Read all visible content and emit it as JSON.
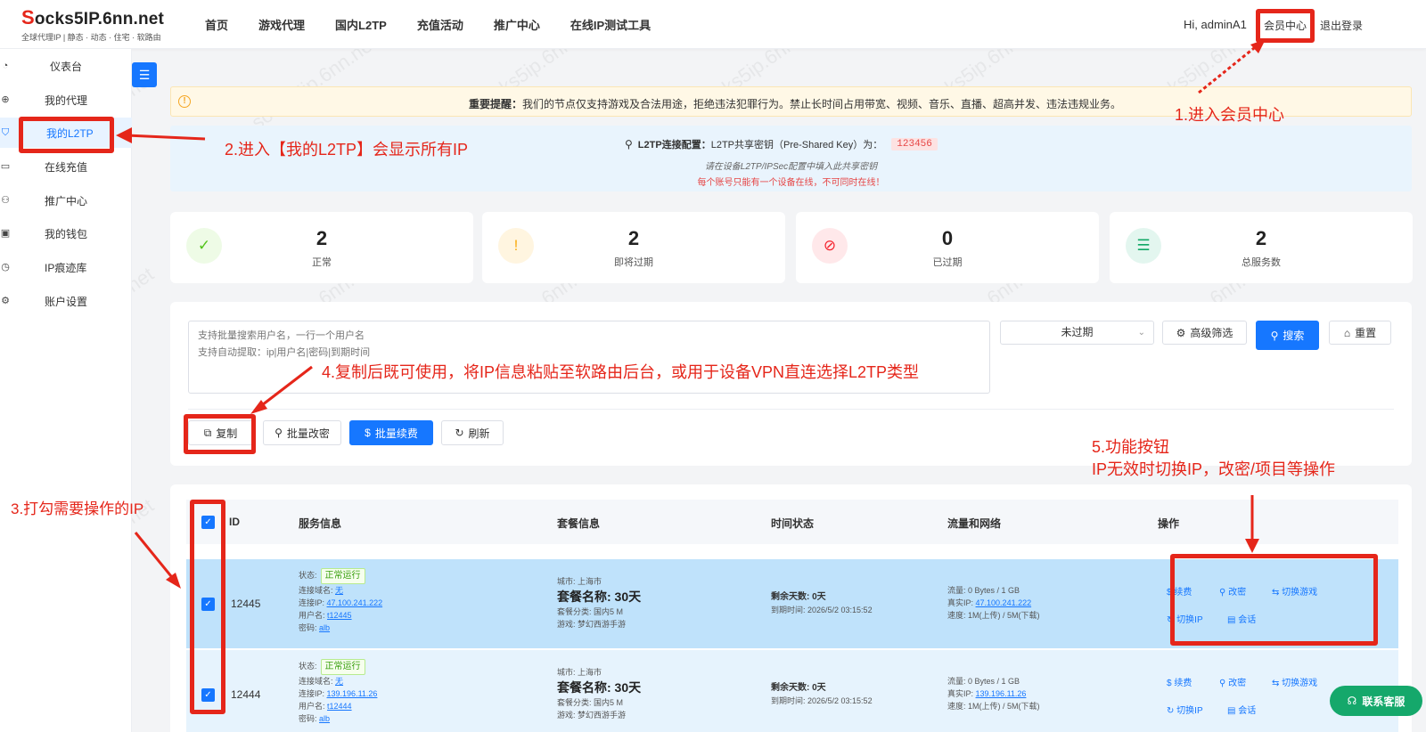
{
  "logo": {
    "initial": "S",
    "rest": "ocks5IP.6nn.net",
    "subtitle": "全球代理IP | 静态 · 动态 · 住宅 · 软路由"
  },
  "topnav": [
    "首页",
    "游戏代理",
    "国内L2TP",
    "充值活动",
    "推广中心",
    "在线IP测试工具"
  ],
  "user": {
    "greeting": "Hi, adminA1",
    "member_center": "会员中心",
    "logout": "退出登录"
  },
  "sidebar": [
    {
      "label": "仪表台",
      "icon": "dashboard-icon"
    },
    {
      "label": "我的代理",
      "icon": "globe-icon"
    },
    {
      "label": "我的L2TP",
      "icon": "shield-icon",
      "active": true
    },
    {
      "label": "在线充值",
      "icon": "card-icon"
    },
    {
      "label": "推广中心",
      "icon": "users-icon"
    },
    {
      "label": "我的钱包",
      "icon": "wallet-icon"
    },
    {
      "label": "IP痕迹库",
      "icon": "history-icon"
    },
    {
      "label": "账户设置",
      "icon": "gear-icon"
    }
  ],
  "notice": {
    "bold": "重要提醒：",
    "text": "我们的节点仅支持游戏及合法用途，拒绝违法犯罪行为。禁止长时间占用带宽、视频、音乐、直播、超高并发、违法违规业务。"
  },
  "l2tp_config": {
    "label": "L2TP连接配置：",
    "desc": "L2TP共享密钥（Pre-Shared Key）为：",
    "key": "123456",
    "hint": "请在设备L2TP/IPSec配置中填入此共享密钥",
    "warning": "每个账号只能有一个设备在线，不可同时在线！"
  },
  "stats": [
    {
      "value": "2",
      "label": "正常",
      "color": "#52c41a",
      "bg": "#eefbe6",
      "icon": "check-circle-icon"
    },
    {
      "value": "2",
      "label": "即将过期",
      "color": "#faad14",
      "bg": "#fff5e0",
      "icon": "warning-circle-icon"
    },
    {
      "value": "0",
      "label": "已过期",
      "color": "#f5222d",
      "bg": "#ffe8ea",
      "icon": "ban-icon"
    },
    {
      "value": "2",
      "label": "总服务数",
      "color": "#13a867",
      "bg": "#e3f6ef",
      "icon": "server-icon"
    }
  ],
  "search": {
    "placeholder": "支持批量搜索用户名，一行一个用户名\n支持自动提取：ip|用户名|密码|到期时间",
    "filter_value": "未过期",
    "advanced": "高级筛选",
    "search": "搜索",
    "reset": "重置"
  },
  "actions": {
    "copy": "复制",
    "batch_password": "批量改密",
    "batch_renew": "批量续费",
    "refresh": "刷新"
  },
  "table": {
    "headers": [
      "ID",
      "服务信息",
      "套餐信息",
      "时间状态",
      "流量和网络",
      "操作"
    ],
    "rows": [
      {
        "id": "12445",
        "status_label": "状态:",
        "status": "正常运行",
        "domain_label": "连接域名:",
        "domain": "无",
        "ip_label": "连接IP:",
        "ip": "47.100.241.222",
        "user_label": "用户名:",
        "user": "t12445",
        "pwd_label": "密码:",
        "pwd": "alb",
        "city": "城市: 上海市",
        "package": "套餐名称: 30天",
        "category": "套餐分类: 国内5 M",
        "game": "游戏: 梦幻西游手游",
        "remaining": "剩余天数: 0天",
        "expire": "到期时间: 2026/5/2 03:15:52",
        "traffic": "流量: 0 Bytes / 1 GB",
        "real_ip_label": "真实IP:",
        "real_ip": "47.100.241.222",
        "speed": "速度: 1M(上传) / 5M(下载)"
      },
      {
        "id": "12444",
        "status_label": "状态:",
        "status": "正常运行",
        "domain_label": "连接域名:",
        "domain": "无",
        "ip_label": "连接IP:",
        "ip": "139.196.11.26",
        "user_label": "用户名:",
        "user": "t12444",
        "pwd_label": "密码:",
        "pwd": "alb",
        "city": "城市: 上海市",
        "package": "套餐名称: 30天",
        "category": "套餐分类: 国内5 M",
        "game": "游戏: 梦幻西游手游",
        "remaining": "剩余天数: 0天",
        "expire": "到期时间: 2026/5/2 03:15:52",
        "traffic": "流量: 0 Bytes / 1 GB",
        "real_ip_label": "真实IP:",
        "real_ip": "139.196.11.26",
        "speed": "速度: 1M(上传) / 5M(下载)"
      }
    ],
    "ops": {
      "renew": "续费",
      "change_pwd": "改密",
      "switch_game": "切换游戏",
      "switch_ip": "切换IP",
      "session": "会话"
    }
  },
  "annotations": {
    "a1": "1.进入会员中心",
    "a2": "2.进入【我的L2TP】会显示所有IP",
    "a3": "3.打勾需要操作的IP",
    "a4": "4.复制后既可使用，将IP信息粘贴至软路由后台，或用于设备VPN直连选择L2TP类型",
    "a5_line1": "5.功能按钮",
    "a5_line2": "IP无效时切换IP，改密/项目等操作"
  },
  "watermark": "socks5ip.6nn.net",
  "service_button": "联系客服",
  "colors": {
    "primary": "#1677ff",
    "annotation": "#e5261a",
    "row_selected": "#bfe2fb"
  }
}
